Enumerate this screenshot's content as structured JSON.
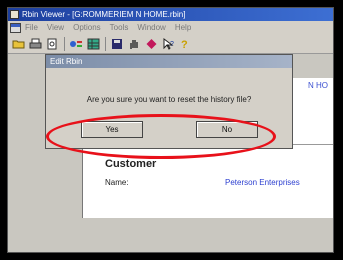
{
  "window": {
    "title": "Rbin Viewer - [G:ROMMERIEM N HOME.rbin]"
  },
  "menu": [
    "File",
    "View",
    "Options",
    "Tools",
    "Window",
    "Help"
  ],
  "toolbar": {
    "icons": [
      "open-folder-icon",
      "print-icon",
      "print-preview-icon",
      "search-replace-icon",
      "grid-icon",
      "save-icon",
      "hand-icon",
      "diamond-icon",
      "help-arrow-icon",
      "question-icon"
    ]
  },
  "document": {
    "link_text": "N HO",
    "customer_heading": "Customer",
    "name_label": "Name:",
    "name_value": "Peterson Enterprises"
  },
  "dialog": {
    "title": "Edit Rbin",
    "message": "Are you sure you want to reset the history file?",
    "yes_label": "Yes",
    "no_label": "No"
  },
  "colors": {
    "highlight_ring": "#e8111a",
    "title_bar": "#1d3f9e",
    "link": "#3a4fd0"
  }
}
